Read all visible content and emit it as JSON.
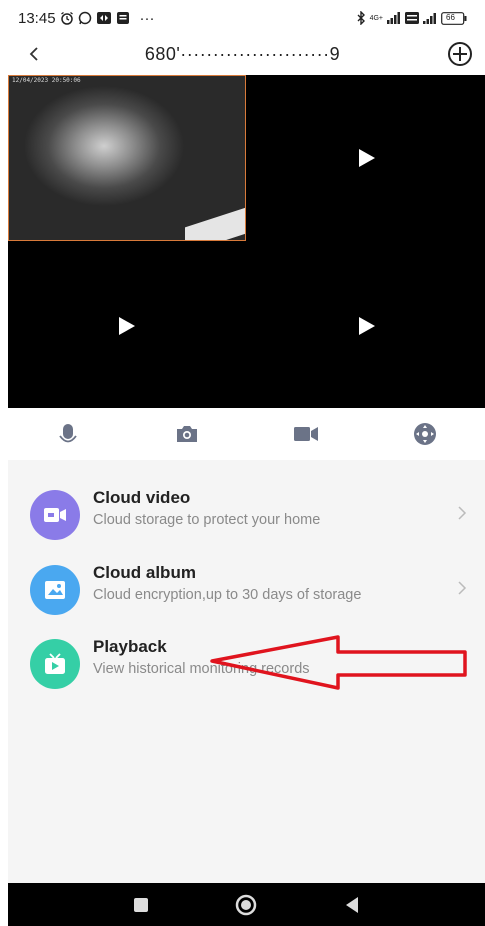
{
  "status_bar": {
    "time": "13:45",
    "more": "···",
    "network": "4G+",
    "battery": "66"
  },
  "header": {
    "device_name": "680'·······················9",
    "back_icon": "chevron-left-icon",
    "add_icon": "circle-plus-icon"
  },
  "video": {
    "timestamp": "12/04/2023 20:50:06",
    "play_icon": "play-icon"
  },
  "controls": [
    {
      "icon": "microphone-icon"
    },
    {
      "icon": "camera-icon"
    },
    {
      "icon": "video-camera-icon"
    },
    {
      "icon": "joystick-icon"
    }
  ],
  "menu": [
    {
      "title": "Cloud video",
      "subtitle": "Cloud storage to protect your home",
      "icon": "cloud-video-icon",
      "color": "#8a7be8",
      "has_chevron": true
    },
    {
      "title": "Cloud album",
      "subtitle": "Cloud encryption,up to 30 days of storage",
      "icon": "cloud-album-icon",
      "color": "#4aa8f0",
      "has_chevron": true
    },
    {
      "title": "Playback",
      "subtitle": "View historical monitoring records",
      "icon": "playback-tv-icon",
      "color": "#35cfa6",
      "has_chevron": false
    }
  ],
  "annotation": {
    "color": "#e0141e",
    "icon": "arrow-left-icon"
  },
  "colors": {
    "accent_orange": "#d87a3a",
    "background": "#f5f5f5"
  }
}
